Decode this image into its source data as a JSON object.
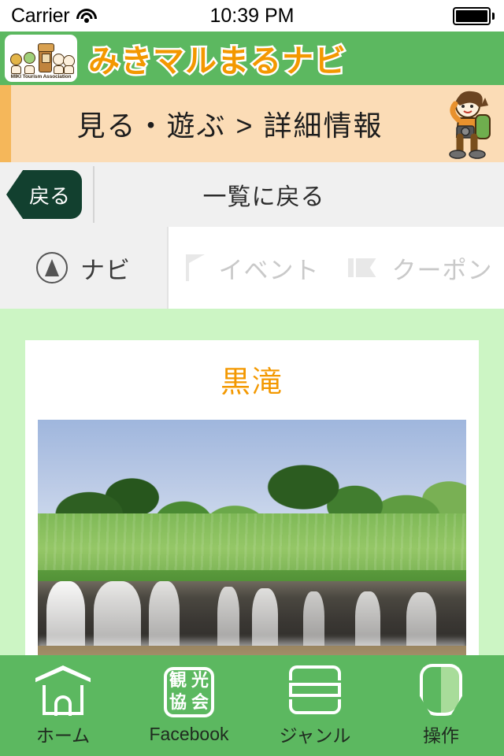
{
  "status_bar": {
    "carrier": "Carrier",
    "wifi_icon": "wifi-icon",
    "time": "10:39 PM",
    "battery_icon": "battery-full-icon"
  },
  "app_header": {
    "logo_caption": "MIKI Tourism Association",
    "title": "みきマルまるナビ",
    "title_color": "#f39800",
    "background_color": "#5cb860"
  },
  "breadcrumb": {
    "text": "見る・遊ぶ > 詳細情報",
    "character_icon": "hiker-character-icon",
    "background_color": "#fbdcb6",
    "accent_color": "#f5b75a"
  },
  "back_row": {
    "back_button_label": "戻る",
    "back_to_list_label": "一覧に戻る",
    "button_color": "#12402f"
  },
  "tabs": [
    {
      "label": "ナビ",
      "icon": "navigation-arrow-icon",
      "active": true
    },
    {
      "label": "イベント",
      "icon": "flag-icon",
      "active": false
    },
    {
      "label": "クーポン",
      "icon": "ticket-icon",
      "active": false
    }
  ],
  "content": {
    "background_color": "#ccf5c4",
    "title": "黒滝",
    "title_color": "#f39800",
    "photo_alt": "黒滝 waterfall photo"
  },
  "bottom_nav": [
    {
      "label": "ホーム",
      "icon": "home-icon"
    },
    {
      "label": "Facebook",
      "icon": "tourism-association-stamp-icon"
    },
    {
      "label": "ジャンル",
      "icon": "list-bars-icon"
    },
    {
      "label": "操作",
      "icon": "young-leaf-icon"
    }
  ],
  "stamp_chars": [
    "観",
    "光",
    "協",
    "会"
  ]
}
